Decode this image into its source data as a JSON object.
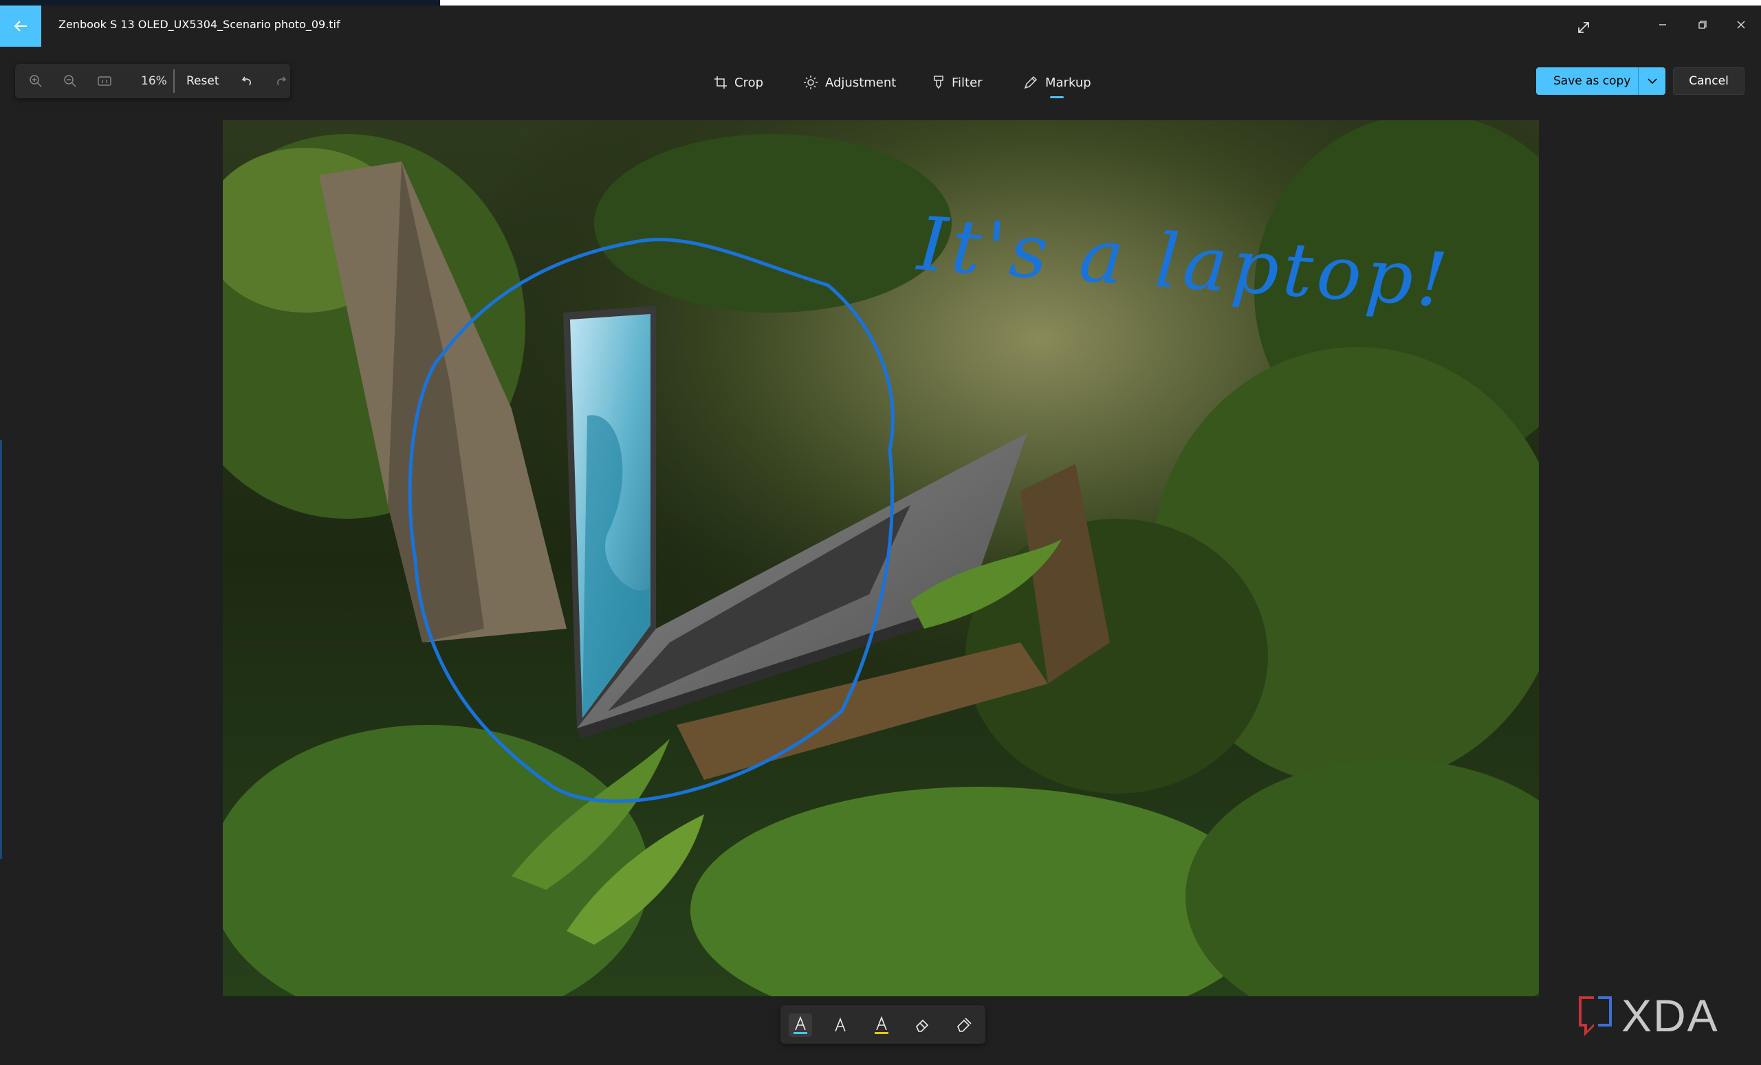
{
  "window": {
    "title": "Zenbook S 13 OLED_UX5304_Scenario photo_09.tif"
  },
  "toolbar": {
    "zoom_level": "16%",
    "reset_label": "Reset"
  },
  "tabs": [
    {
      "label": "Crop",
      "icon": "crop-icon"
    },
    {
      "label": "Adjustment",
      "icon": "brightness-icon"
    },
    {
      "label": "Filter",
      "icon": "filter-icon"
    },
    {
      "label": "Markup",
      "icon": "pen-icon",
      "active": true
    }
  ],
  "actions": {
    "save_label": "Save as copy",
    "cancel_label": "Cancel"
  },
  "annotation": {
    "text": "It's a laptop!",
    "color": "#1a73d9"
  },
  "markup_tools": [
    "ballpoint-pen-icon",
    "pencil-icon",
    "highlighter-icon",
    "eraser-icon",
    "clear-all-icon"
  ],
  "colors": {
    "accent": "#4cc2ff",
    "background": "#202020",
    "panel": "#2b2b2b"
  },
  "watermark": {
    "text": "XDA"
  }
}
